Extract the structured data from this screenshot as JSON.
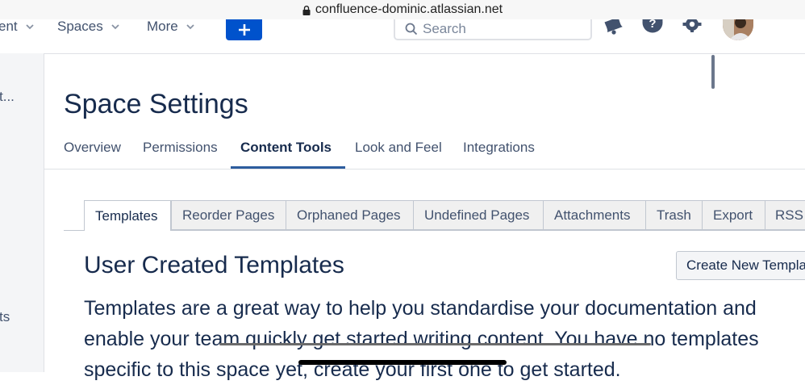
{
  "browser": {
    "url": "confluence-dominic.atlassian.net"
  },
  "topnav": {
    "items": [
      {
        "label": "ent"
      },
      {
        "label": "Spaces"
      },
      {
        "label": "More"
      }
    ],
    "search_placeholder": "Search"
  },
  "sidebar": {
    "fragments": [
      "t...",
      "ts"
    ]
  },
  "page": {
    "title": "Space Settings",
    "tabs": [
      {
        "label": "Overview"
      },
      {
        "label": "Permissions"
      },
      {
        "label": "Content Tools",
        "active": true
      },
      {
        "label": "Look and Feel"
      },
      {
        "label": "Integrations"
      }
    ]
  },
  "content_tools": {
    "tabs": [
      {
        "label": "Templates",
        "active": true
      },
      {
        "label": "Reorder Pages"
      },
      {
        "label": "Orphaned Pages"
      },
      {
        "label": "Undefined Pages"
      },
      {
        "label": "Attachments"
      },
      {
        "label": "Trash"
      },
      {
        "label": "Export"
      },
      {
        "label": "RSS"
      }
    ],
    "section_title": "User Created Templates",
    "create_button": "Create New Template",
    "description": "Templates are a great way to help you standardise your documentation and enable your team quickly get started writing content. You have no templates specific to this space yet, create your first one to get started."
  },
  "colors": {
    "primary": "#0052cc",
    "title_text": "#172b4d",
    "secondary_text": "#42526e",
    "active_tab_underline": "#2d5d9e"
  },
  "icons": [
    "lock-icon",
    "chevron-down-icon",
    "plus-icon",
    "search-icon",
    "bell-icon",
    "help-icon",
    "settings-icon",
    "avatar"
  ]
}
